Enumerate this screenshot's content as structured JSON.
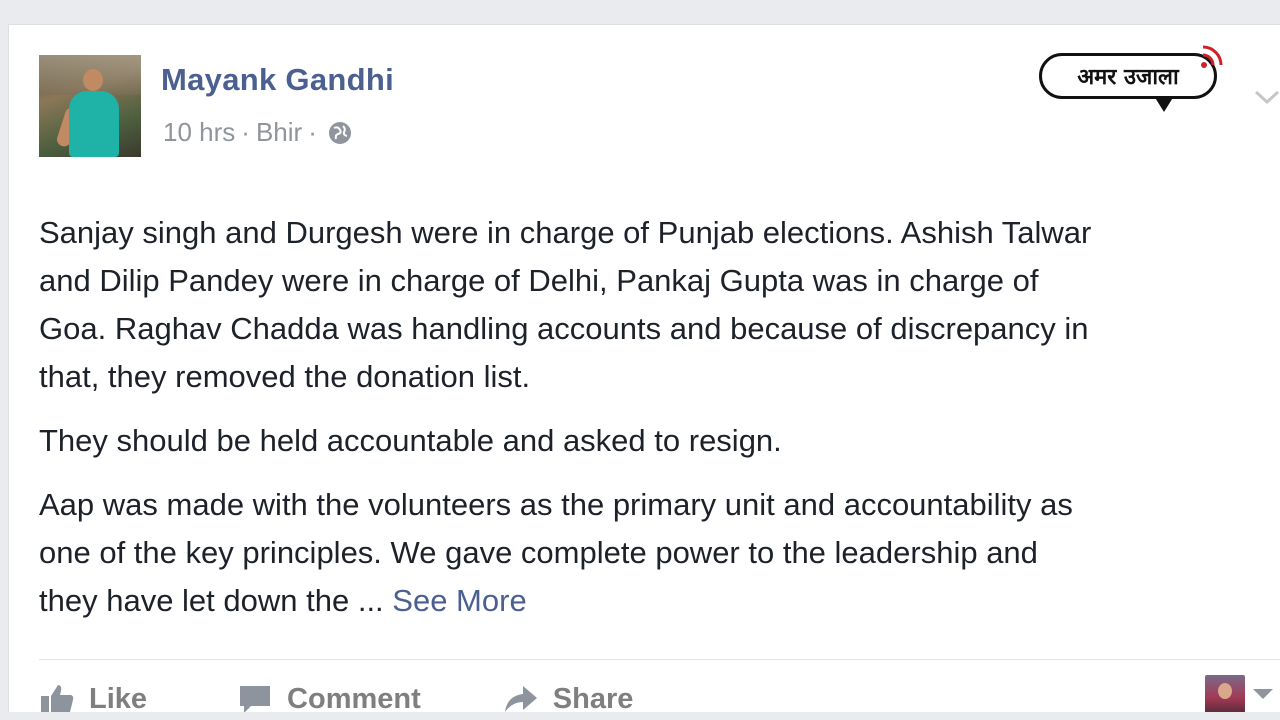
{
  "post": {
    "author": "Mayank Gandhi",
    "time": "10 hrs",
    "separator": "·",
    "location": "Bhir",
    "paragraphs": [
      [
        "Sanjay singh and Durgesh were in charge of Punjab elections. Ashish Talwar",
        "and Dilip Pandey were in charge of Delhi, Pankaj Gupta was in charge of",
        "Goa. Raghav Chadda was handling accounts and because of discrepancy in",
        "that, they removed the donation list."
      ],
      [
        "They should be held accountable and asked to resign."
      ],
      [
        "Aap was made with the volunteers as the primary unit and accountability as",
        "one of the key principles. We gave complete power to the leadership and"
      ]
    ],
    "last_line_prefix": "they have let down the ... ",
    "see_more": "See More"
  },
  "actions": {
    "like": "Like",
    "comment": "Comment",
    "share": "Share"
  },
  "watermark": {
    "text": "अमर उजाला"
  },
  "icons": {
    "globe": "globe-icon",
    "like": "thumbs-up-icon",
    "comment": "comment-bubble-icon",
    "share": "share-arrow-icon",
    "menu": "chevron-down-icon"
  },
  "colors": {
    "author": "#4b5f91",
    "link": "#4b5f91",
    "text": "#1d2129",
    "meta": "#90949c",
    "action": "#7f7f7f"
  }
}
